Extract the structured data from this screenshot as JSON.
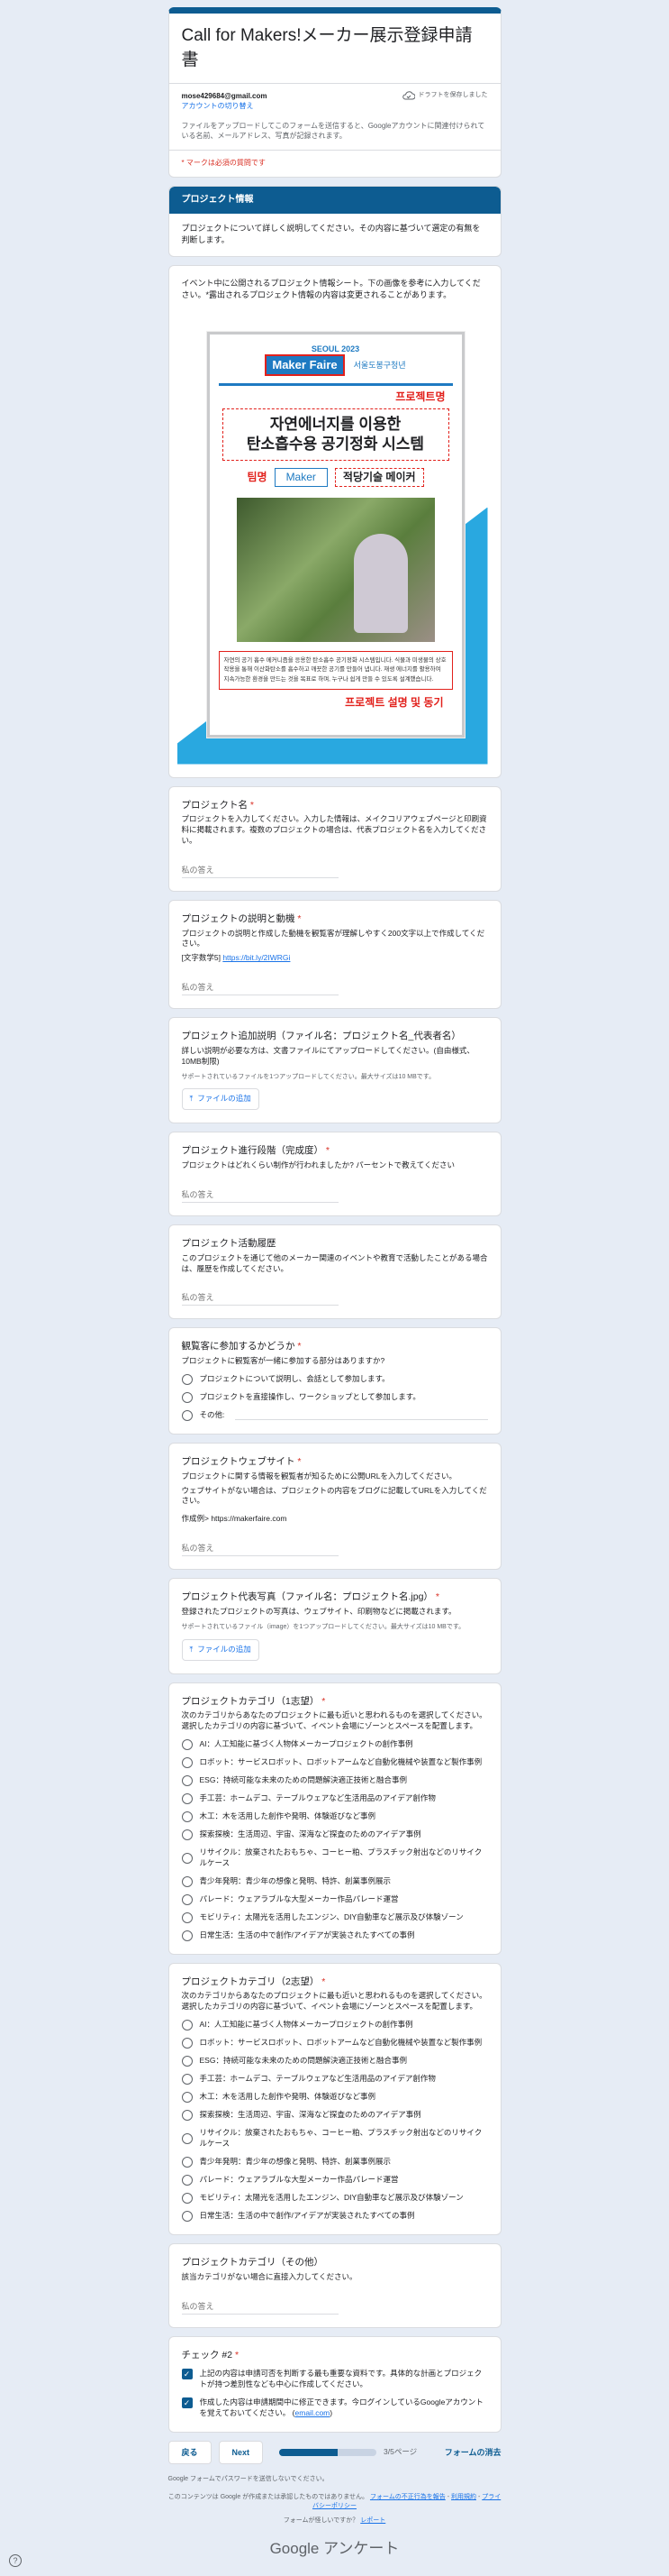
{
  "form": {
    "title": "Call for Makers!メーカー展示登録申請書",
    "email": "mose429684@gmail.com",
    "switch_account": "アカウントの切り替え",
    "saved": "ドラフトを保存しました",
    "notice": "ファイルをアップロードしてこのフォームを送信すると、Googleアカウントに関連付けられている名前、メールアドレス、写真が記録されます。",
    "required_note": "* マークは必須の質問です"
  },
  "section": {
    "title": "プロジェクト情報",
    "desc": "プロジェクトについて詳しく説明してください。その内容に基づいて選定の有無を判断します。"
  },
  "poster_intro": "イベント中に公開されるプロジェクト情報シート。下の画像を参考に入力してください。*露出されるプロジェクト情報の内容は変更されることがあります。",
  "poster": {
    "seoul": "SEOUL 2023",
    "maker": "Maker Faire",
    "org": "서울도봉구청년",
    "proj_label": "프로젝트명",
    "title_line1": "자연에너지를 이용한",
    "title_line2": "탄소흡수용 공기정화 시스템",
    "team_label": "팀명",
    "team_box": "Maker",
    "team_name": "적당기술 메이커",
    "desc": "자연의 공기 흡수 메커니즘을 응용한 탄소흡수 공기정화 시스템입니다. 식물과 미생물의 상호작용을 통해 이산화탄소를 흡수하고 깨끗한 공기를 만들어 냅니다. 재생 에너지를 활용하여 지속가능한 환경을 만드는 것을 목표로 하며, 누구나 쉽게 만들 수 있도록 설계했습니다.",
    "foot": "프로젝트 설명 및 동기"
  },
  "questions": {
    "q1": {
      "title": "プロジェクト名",
      "desc": "プロジェクトを入力してください。入力した情報は、メイクコリアウェブページと印刷資料に掲載されます。複数のプロジェクトの場合は、代表プロジェクト名を入力してください。",
      "placeholder": "私の答え"
    },
    "q2": {
      "title": "プロジェクトの説明と動機",
      "desc": "プロジェクトの説明と作成した動機を観覧客が理解しやすく200文字以上で作成してください。",
      "count_label": "[文字数学5]",
      "count_link": "https://bit.ly/2IWRGi",
      "placeholder": "私の答え"
    },
    "q3": {
      "title": "プロジェクト追加説明（ファイル名：プロジェクト名_代表者名）",
      "desc": "詳しい説明が必要な方は、文書ファイルにてアップロードしてください。(自由様式、10MB制限)",
      "sub": "サポートされているファイルを1つアップロードしてください。最大サイズは10 MBです。",
      "upload": "ファイルの追加"
    },
    "q4": {
      "title": "プロジェクト進行段階（完成度）",
      "desc": "プロジェクトはどれくらい制作が行われましたか? パーセントで教えてください",
      "placeholder": "私の答え"
    },
    "q5": {
      "title": "プロジェクト活動履歴",
      "desc": "このプロジェクトを通じて他のメーカー関連のイベントや教育で活動したことがある場合は、履歴を作成してください。",
      "placeholder": "私の答え"
    },
    "q6": {
      "title": "観覧客に参加するかどうか",
      "desc": "プロジェクトに観覧客が一緒に参加する部分はありますか?",
      "options": [
        "プロジェクトについて説明し、会話として参加します。",
        "プロジェクトを直接操作し、ワークショップとして参加します。",
        "その他:"
      ]
    },
    "q7": {
      "title": "プロジェクトウェブサイト",
      "desc1": "プロジェクトに関する情報を観覧者が知るために公開URLを入力してください。",
      "desc2": "ウェブサイトがない場合は、プロジェクトの内容をブログに記載してURLを入力してください。",
      "example": "作成例> https://makerfaire.com",
      "placeholder": "私の答え"
    },
    "q8": {
      "title": "プロジェクト代表写真（ファイル名：プロジェクト名.jpg）",
      "desc": "登録されたプロジェクトの写真は、ウェブサイト、印刷物などに掲載されます。",
      "sub": "サポートされているファイル（image）を1つアップロードしてください。最大サイズは10 MBです。",
      "upload": "ファイルの追加"
    },
    "q9": {
      "title": "プロジェクトカテゴリ（1志望）",
      "desc": "次のカテゴリからあなたのプロジェクトに最も近いと思われるものを選択してください。選択したカテゴリの内容に基づいて、イベント会場にゾーンとスペースを配置します。"
    },
    "q10": {
      "title": "プロジェクトカテゴリ（2志望）",
      "desc": "次のカテゴリからあなたのプロジェクトに最も近いと思われるものを選択してください。選択したカテゴリの内容に基づいて、イベント会場にゾーンとスペースを配置します。"
    },
    "q11": {
      "title": "プロジェクトカテゴリ（その他）",
      "desc": "該当カテゴリがない場合に直接入力してください。",
      "placeholder": "私の答え"
    },
    "q12": {
      "title": "チェック #2",
      "options": [
        "上記の内容は申請可否を判断する最も重要な資料です。具体的な計画とプロジェクトが持つ差別性なども中心に作成してください。",
        "作成した内容は申請期間中に修正できます。今ログインしているGoogleアカウントを覚えておいてください。"
      ],
      "email_link": "email.com"
    }
  },
  "categories": [
    "AI：人工知能に基づく人物体メーカープロジェクトの創作事例",
    "ロボット：サービスロボット、ロボットアームなど自動化機械や装置など製作事例",
    "ESG：持続可能な未来のための問題解決適正技術と融合事例",
    "手工芸：ホームデコ、テーブルウェアなど生活用品のアイデア創作物",
    "木工：木を活用した創作や発明、体験遊びなど事例",
    "探索探検：生活周辺、宇宙、深海など探査のためのアイデア事例",
    "リサイクル：放棄されたおもちゃ、コーヒー粕、プラスチック射出などのリサイクルケース",
    "青少年発明：青少年の想像と発明、特許、創業事例展示",
    "パレード：ウェアラブルな大型メーカー作品パレード運営",
    "モビリティ：太陽光を活用したエンジン、DIY自動車など展示及び体験ゾーン",
    "日常生活：生活の中で創作/アイデアが実装されたすべての事例"
  ],
  "nav": {
    "back": "戻る",
    "next": "Next",
    "page": "3/5ページ",
    "clear": "フォームの消去",
    "progress_percent": 60
  },
  "footer": {
    "never": "Google フォームでパスワードを送信しないでください。",
    "disclaimer": "このコンテンツは Google が作成または承認したものではありません。",
    "report": "フォームの不正行為を報告",
    "terms": "利用規約",
    "privacy": "プライバシーポリシー",
    "phishing": "フォームが怪しいですか？",
    "report2": "レポート",
    "brand": "Google アンケート"
  },
  "help_icon": "?"
}
